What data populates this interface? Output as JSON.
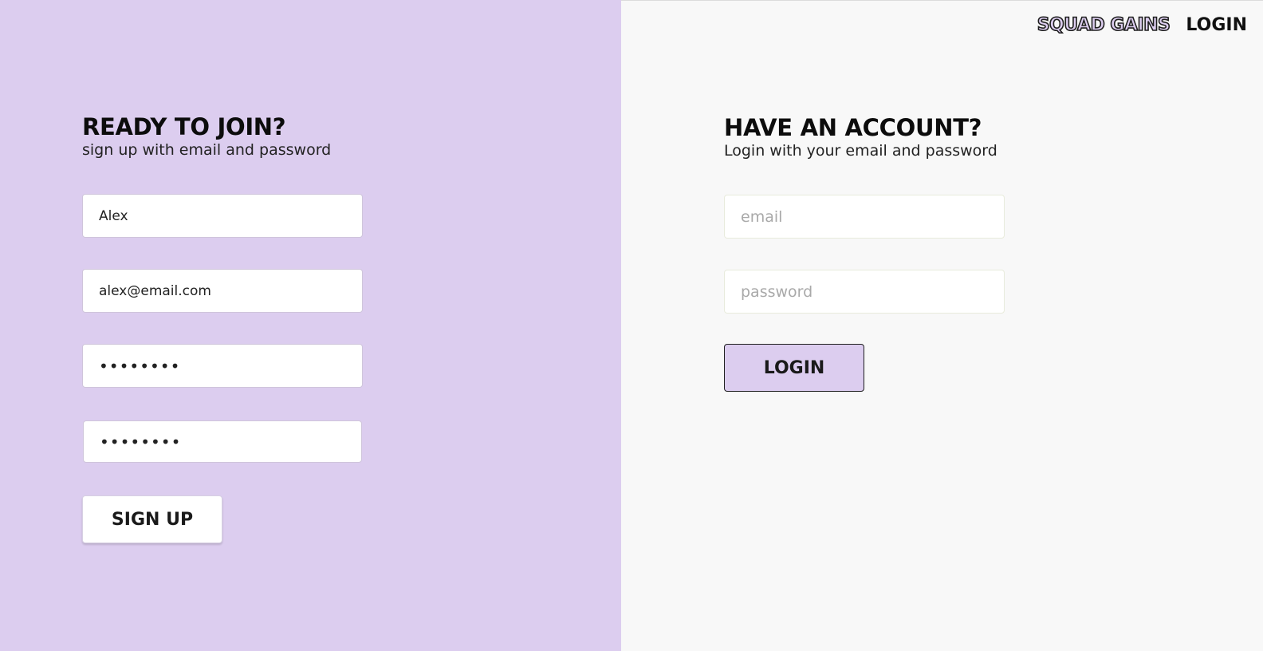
{
  "nav": {
    "brand": "SQUAD GAINS",
    "login_link": "LOGIN"
  },
  "signup": {
    "heading": "READY TO JOIN?",
    "subheading": "sign up with email and password",
    "name_value": "Alex",
    "email_value": "alex@email.com",
    "password_value": "••••••••",
    "confirm_password_value": "••••••••",
    "button_label": "SIGN UP"
  },
  "login": {
    "heading": "HAVE AN ACCOUNT?",
    "subheading": "Login with your email and password",
    "email_placeholder": "email",
    "password_placeholder": "password",
    "button_label": "LOGIN"
  },
  "colors": {
    "accent": "#dccdef",
    "right_bg": "#f8f8f8",
    "text": "#111111"
  }
}
